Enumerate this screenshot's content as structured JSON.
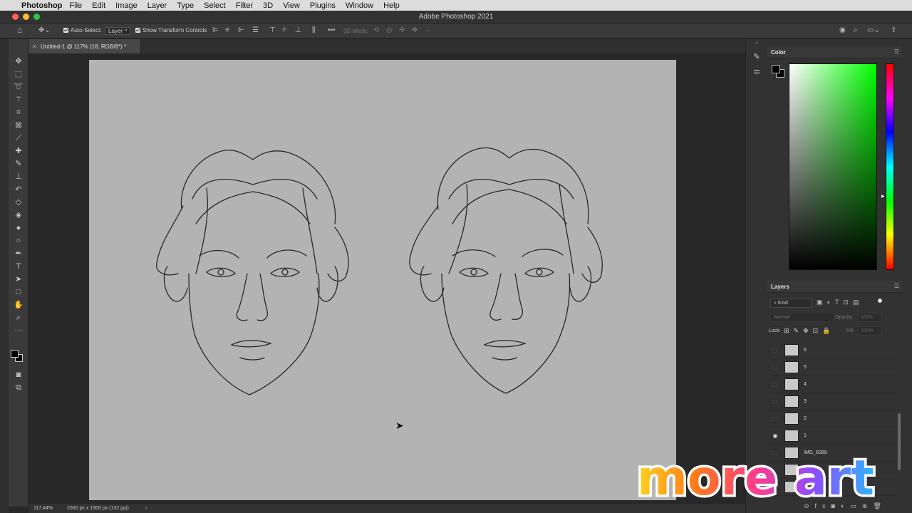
{
  "menubar": {
    "app_name": "Photoshop",
    "items": [
      "File",
      "Edit",
      "Image",
      "Layer",
      "Type",
      "Select",
      "Filter",
      "3D",
      "View",
      "Plugins",
      "Window",
      "Help"
    ]
  },
  "window": {
    "title": "Adobe Photoshop 2021"
  },
  "options": {
    "auto_select_label": "Auto-Select:",
    "auto_select_value": "Layer",
    "transform_controls_label": "Show Transform Controls",
    "mode_3d_label": "3D Mode:"
  },
  "document": {
    "tab_title": "Untitled-1 @ 117% (18, RGB/8*) *"
  },
  "status": {
    "zoom": "117,44%",
    "doc_info": "2000 px x 1500 px (132 ppi)",
    "arrow": "›"
  },
  "color_panel": {
    "title": "Color",
    "foreground": "#000000",
    "background": "#000000"
  },
  "layers_panel": {
    "title": "Layers",
    "filter_label": "Kind",
    "blend_mode": "Normal",
    "opacity_label": "Opacity:",
    "opacity_value": "100%",
    "lock_label": "Lock:",
    "fill_label": "Fill:",
    "fill_value": "100%",
    "layers": [
      {
        "name": "6",
        "visible": false
      },
      {
        "name": "5",
        "visible": false
      },
      {
        "name": "4",
        "visible": false
      },
      {
        "name": "3",
        "visible": false
      },
      {
        "name": "2",
        "visible": false
      },
      {
        "name": "1",
        "visible": true
      },
      {
        "name": "IMG_6389",
        "visible": false
      }
    ]
  },
  "watermark": {
    "text": "more art"
  },
  "colors": {
    "canvas": "#b3b3b3",
    "panel": "#323232",
    "accent_red": "#fe5f57",
    "accent_yellow": "#febc2e",
    "accent_green": "#28c840"
  },
  "icons": {
    "tools": [
      "move-icon",
      "marquee-icon",
      "lasso-icon",
      "magic-wand-icon",
      "crop-icon",
      "frame-icon",
      "eyedropper-icon",
      "healing-brush-icon",
      "brush-icon",
      "clone-stamp-icon",
      "history-brush-icon",
      "eraser-icon",
      "paint-bucket-icon",
      "blur-icon",
      "dodge-icon",
      "pen-icon",
      "type-icon",
      "path-selection-icon",
      "rectangle-icon",
      "hand-icon",
      "zoom-icon",
      "more-tools-icon"
    ]
  }
}
